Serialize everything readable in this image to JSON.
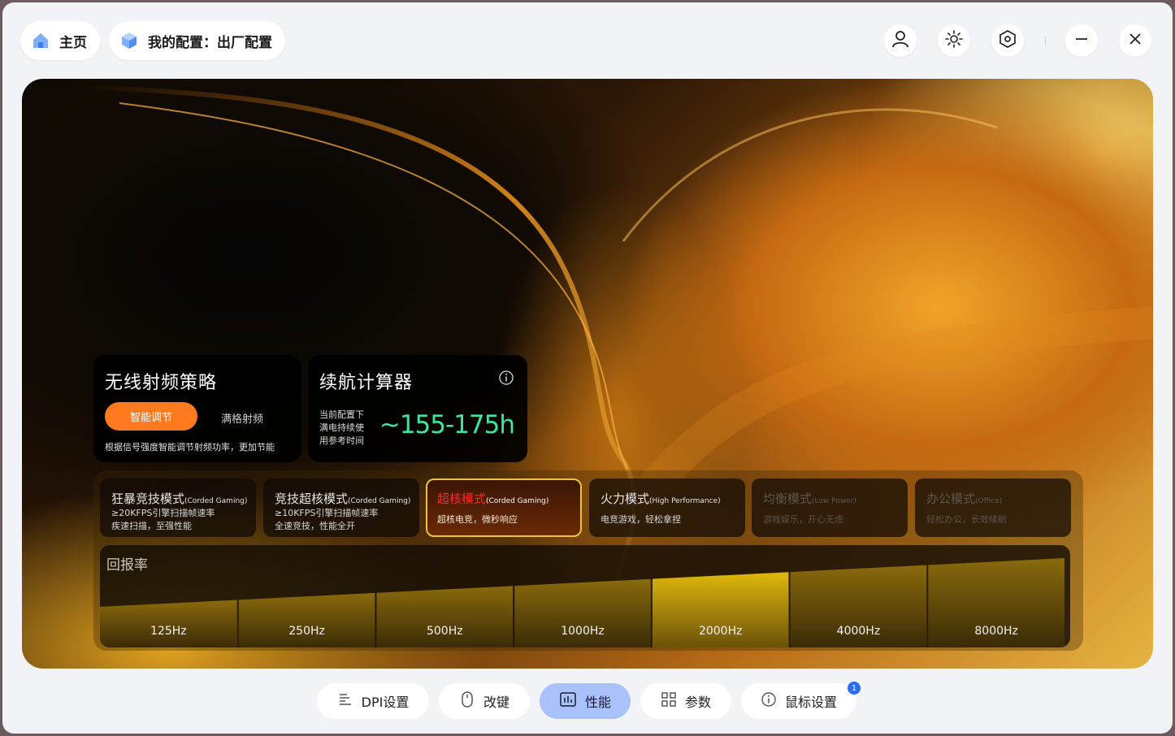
{
  "header": {
    "home_label": "主页",
    "config_label": "我的配置：出厂配置"
  },
  "rf_card": {
    "title": "无线射频策略",
    "option_selected": "智能调节",
    "option_other": "满格射频",
    "description": "根据信号强度智能调节射频功率，更加节能"
  },
  "battery_card": {
    "title": "续航计算器",
    "line1": "当前配置下",
    "line2": "满电持续使",
    "line3": "用参考时间",
    "value": "~155-175h"
  },
  "modes": [
    {
      "title": "狂暴竞技模式",
      "sub": "(Corded Gaming)",
      "line1": "≥20KFPS引擎扫描帧速率",
      "line2": "疾速扫描，至强性能"
    },
    {
      "title": "竞技超核模式",
      "sub": "(Corded Gaming)",
      "line1": "≥10KFPS引擎扫描帧速率",
      "line2": "全速竞技，性能全开"
    },
    {
      "title": "超核模式",
      "sub": "(Corded Gaming)",
      "line1": "超核电竞，微秒响应"
    },
    {
      "title": "火力模式",
      "sub": "(High Performance)",
      "line1": "电竞游戏，轻松拿捏"
    },
    {
      "title": "均衡模式",
      "sub": "(Low Power)",
      "line1": "游戏娱乐，开心无虑"
    },
    {
      "title": "办公模式",
      "sub": "(Office)",
      "line1": "轻松办公，长效续航"
    }
  ],
  "polling": {
    "label": "回报率",
    "rates": [
      "125Hz",
      "250Hz",
      "500Hz",
      "1000Hz",
      "2000Hz",
      "4000Hz",
      "8000Hz"
    ],
    "selected": "2000Hz"
  },
  "nav": {
    "dpi": "DPI设置",
    "keys": "改键",
    "perf": "性能",
    "params": "参数",
    "mouse": "鼠标设置",
    "mouse_badge": "1"
  },
  "colors": {
    "accent_orange": "#ff7a1f",
    "battery_green": "#3ee69a",
    "selected_mode_border": "#f0c23a",
    "nav_active": "#a9c2fb"
  }
}
